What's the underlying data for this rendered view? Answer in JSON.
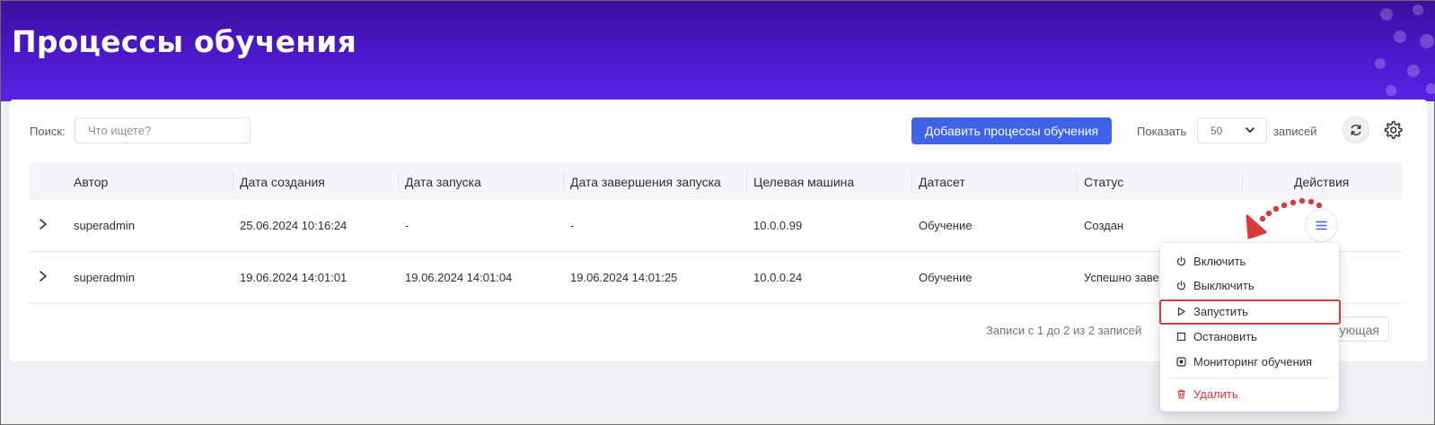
{
  "page": {
    "title": "Процессы обучения"
  },
  "toolbar": {
    "search_label": "Поиск:",
    "search_placeholder": "Что ищете?",
    "search_value": "",
    "add_button": "Добавить процессы обучения",
    "show_label": "Показать",
    "page_size": "50",
    "records_label": "записей"
  },
  "table": {
    "columns": [
      "Автор",
      "Дата создания",
      "Дата запуска",
      "Дата завершения запуска",
      "Целевая машина",
      "Датасет",
      "Статус",
      "Действия"
    ],
    "rows": [
      {
        "author": "superadmin",
        "created": "25.06.2024 10:16:24",
        "started": "-",
        "finished": "-",
        "machine": "10.0.0.99",
        "dataset": "Обучение",
        "status": "Создан"
      },
      {
        "author": "superadmin",
        "created": "19.06.2024 14:01:01",
        "started": "19.06.2024 14:01:04",
        "finished": "19.06.2024 14:01:25",
        "machine": "10.0.0.24",
        "dataset": "Обучение",
        "status": "Успешно заве"
      }
    ]
  },
  "footer": {
    "info": "Записи с 1 до 2 из 2 записей",
    "next_partial": "ующая"
  },
  "actions_menu": {
    "items": [
      {
        "label": "Включить",
        "icon": "power-icon"
      },
      {
        "label": "Выключить",
        "icon": "power-icon"
      },
      {
        "label": "Запустить",
        "icon": "play-icon"
      },
      {
        "label": "Остановить",
        "icon": "stop-icon"
      },
      {
        "label": "Мониторинг обучения",
        "icon": "monitor-icon"
      },
      {
        "label": "Удалить",
        "icon": "trash-icon"
      }
    ],
    "highlighted_item": "Запустить"
  },
  "colors": {
    "header_gradient_top": "#3b0f9e",
    "header_gradient_bottom": "#5a22e6",
    "primary_button": "#3e63e8",
    "danger": "#d63b3b",
    "annotation": "#d63a3a"
  }
}
